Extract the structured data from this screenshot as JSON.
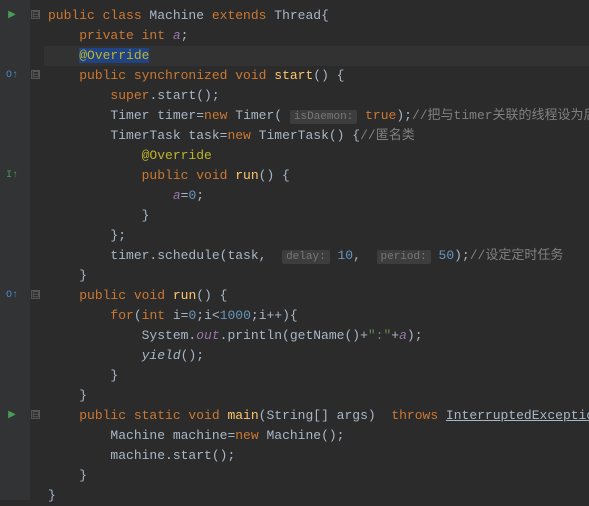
{
  "code": {
    "l1": {
      "p1": "public class ",
      "p2": "Machine ",
      "p3": "extends ",
      "p4": "Thread{"
    },
    "l2": {
      "p1": "private int ",
      "p2": "a",
      "p3": ";"
    },
    "l3": {
      "p1": "@Override"
    },
    "l4": {
      "p1": "public synchronized void ",
      "p2": "start",
      "p3": "() {"
    },
    "l5": {
      "p1": "super",
      "p2": ".start();"
    },
    "l6": {
      "p1": "Timer timer=",
      "p2": "new ",
      "p3": "Timer(",
      "h1": "isDaemon:",
      "p4": " true",
      "p5": ");",
      "c": "//把与timer关联的线程设为后台线程"
    },
    "l7": {
      "p1": "TimerTask task=",
      "p2": "new ",
      "p3": "TimerTask() {",
      "c": "//匿名类"
    },
    "l8": {
      "p1": "@Override"
    },
    "l9": {
      "p1": "public void ",
      "p2": "run",
      "p3": "() {"
    },
    "l10": {
      "p1": "a",
      "p2": "=",
      "p3": "0",
      "p4": ";"
    },
    "l11": {
      "p1": "}"
    },
    "l12": {
      "p1": "};"
    },
    "l13": {
      "p1": "timer.schedule(task, ",
      "h1": "delay:",
      "p2": " 10",
      "p3": ", ",
      "h2": "period:",
      "p4": " 50",
      "p5": ");",
      "c": "//设定定时任务"
    },
    "l14": {
      "p1": "}"
    },
    "l15": {
      "p1": "public void ",
      "p2": "run",
      "p3": "() {"
    },
    "l16": {
      "p1": "for",
      "p2": "(",
      "p3": "int ",
      "p4": "i=",
      "p5": "0",
      "p6": ";i<",
      "p7": "1000",
      "p8": ";i++){"
    },
    "l17": {
      "p1": "System.",
      "p2": "out",
      "p3": ".println(getName()+",
      "p4": "\":\"",
      "p5": "+",
      "p6": "a",
      "p7": ");"
    },
    "l18": {
      "p1": "yield",
      "p2": "();"
    },
    "l19": {
      "p1": "}"
    },
    "l20": {
      "p1": "}"
    },
    "l21": {
      "p1": "public static void ",
      "p2": "main",
      "p3": "(String[] args) ",
      "p4": "throws ",
      "p5": "InterruptedException",
      "p6": " {"
    },
    "l22": {
      "p1": "Machine machine=",
      "p2": "new ",
      "p3": "Machine();"
    },
    "l23": {
      "p1": "machine.start();"
    },
    "l24": {
      "p1": "}"
    },
    "l25": {
      "p1": "}"
    }
  },
  "icons": {
    "run1": "▶",
    "run2": "▶",
    "override1": "O↑",
    "override2": "O↑",
    "impl": "I↑",
    "fold": "⊟"
  }
}
